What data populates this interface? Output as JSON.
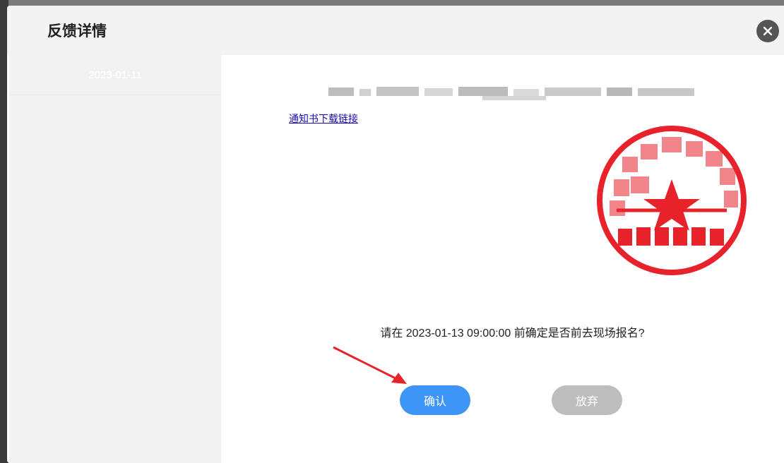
{
  "dialog": {
    "title": "反馈详情",
    "close_icon": "close-icon"
  },
  "sidebar": {
    "items": [
      {
        "label": "2023-01-11"
      }
    ]
  },
  "content": {
    "notice_link": "通知书下载链接",
    "question": "请在 2023-01-13 09:00:00 前确定是否前去现场报名?",
    "confirm_label": "确认",
    "abandon_label": "放弃",
    "seal_icon": "official-seal-icon",
    "arrow_icon": "red-arrow-icon"
  },
  "colors": {
    "confirm": "#3d96f5",
    "abandon": "#bdbdbd",
    "seal": "#e8222a"
  }
}
